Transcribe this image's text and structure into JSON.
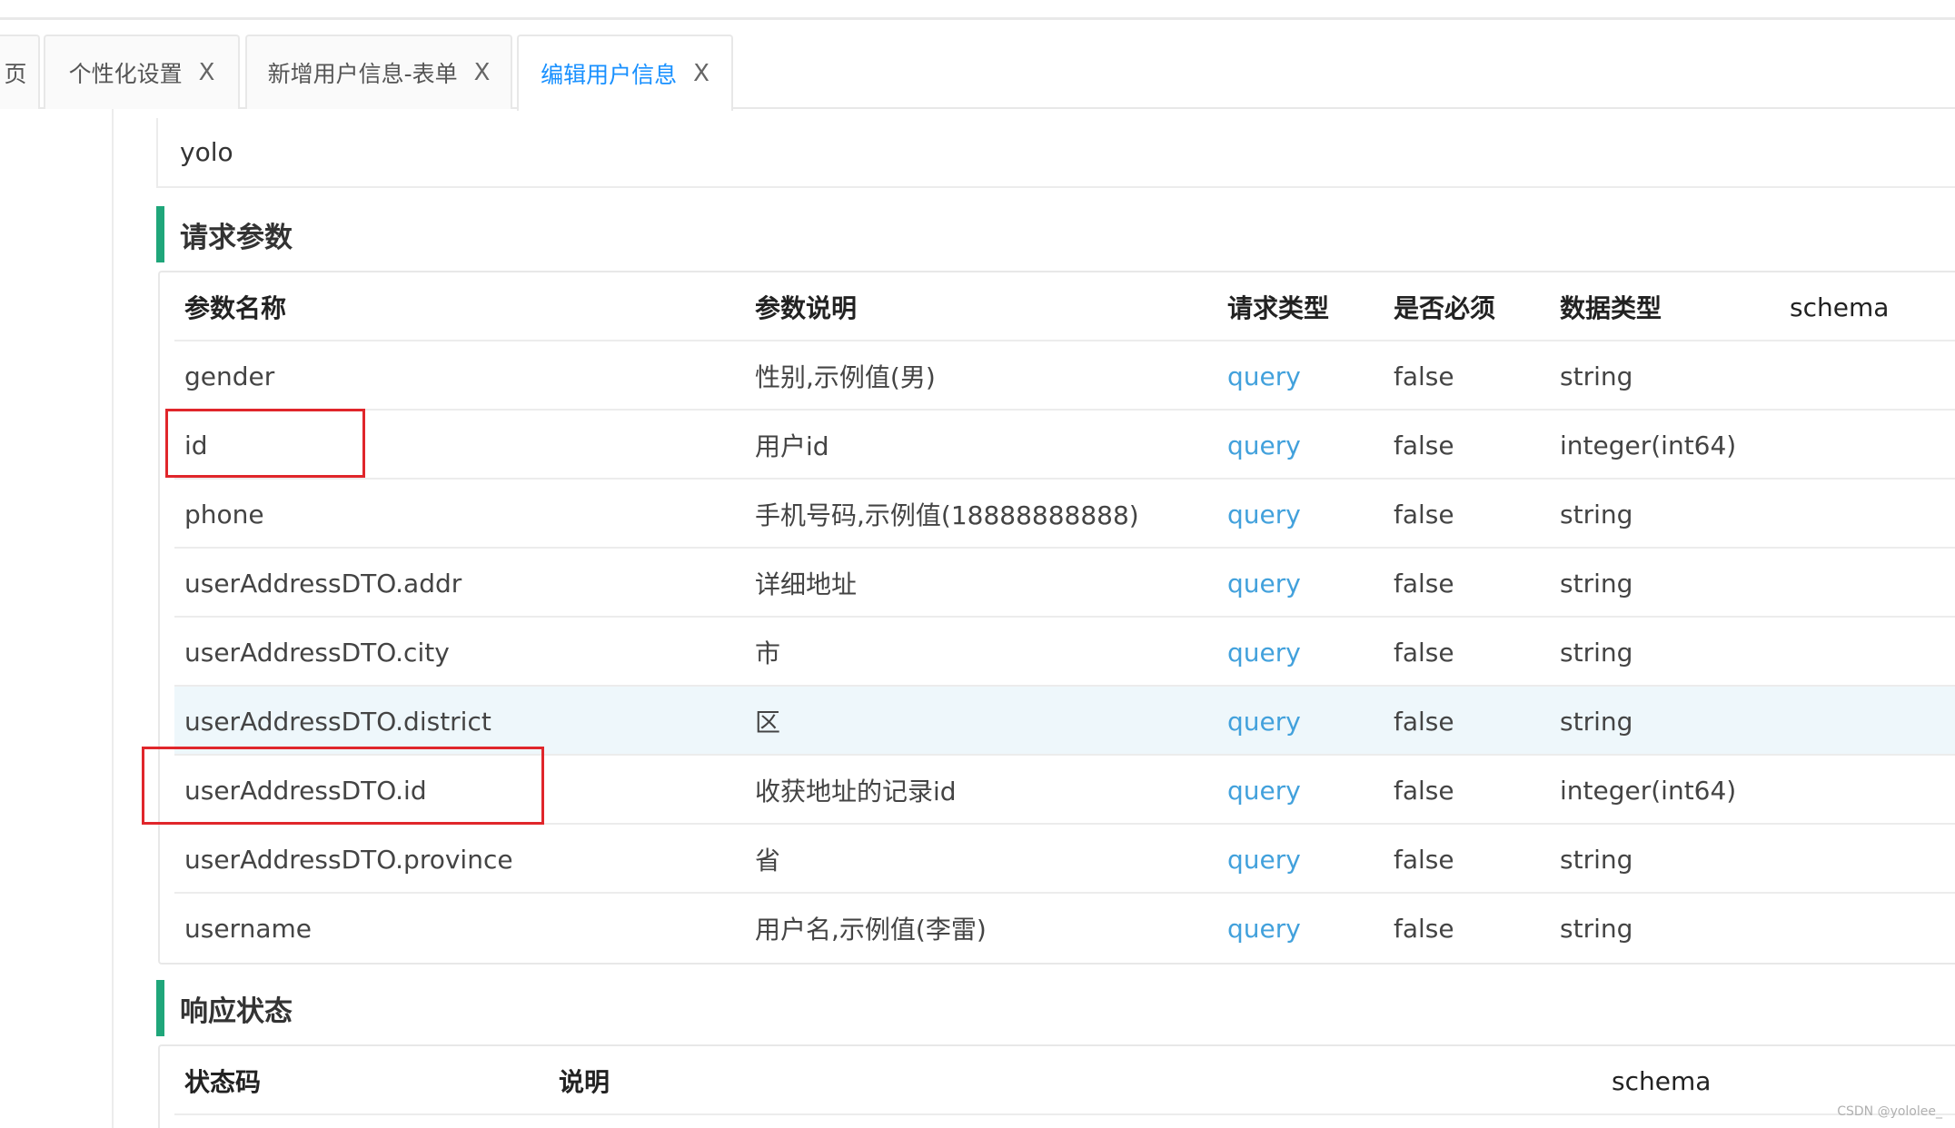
{
  "tabs": [
    {
      "label": "页",
      "active": false,
      "closable": false
    },
    {
      "label": "个性化设置",
      "active": false,
      "closable": true
    },
    {
      "label": "新增用户信息-表单",
      "active": false,
      "closable": true
    },
    {
      "label": "编辑用户信息",
      "active": true,
      "closable": true
    }
  ],
  "close_glyph": "X",
  "url_box": {
    "text": "yolo"
  },
  "request_params": {
    "title": "请求参数",
    "headers": [
      "参数名称",
      "参数说明",
      "请求类型",
      "是否必须",
      "数据类型",
      "schema"
    ],
    "rows": [
      {
        "name": "gender",
        "desc": "性别,示例值(男)",
        "in": "query",
        "required": "false",
        "type": "string"
      },
      {
        "name": "id",
        "desc": "用户id",
        "in": "query",
        "required": "false",
        "type": "integer(int64)"
      },
      {
        "name": "phone",
        "desc": "手机号码,示例值(18888888888)",
        "in": "query",
        "required": "false",
        "type": "string"
      },
      {
        "name": "userAddressDTO.addr",
        "desc": "详细地址",
        "in": "query",
        "required": "false",
        "type": "string"
      },
      {
        "name": "userAddressDTO.city",
        "desc": "市",
        "in": "query",
        "required": "false",
        "type": "string"
      },
      {
        "name": "userAddressDTO.district",
        "desc": "区",
        "in": "query",
        "required": "false",
        "type": "string"
      },
      {
        "name": "userAddressDTO.id",
        "desc": "收获地址的记录id",
        "in": "query",
        "required": "false",
        "type": "integer(int64)"
      },
      {
        "name": "userAddressDTO.province",
        "desc": "省",
        "in": "query",
        "required": "false",
        "type": "string"
      },
      {
        "name": "username",
        "desc": "用户名,示例值(李雷)",
        "in": "query",
        "required": "false",
        "type": "string"
      }
    ],
    "highlighted_row": "userAddressDTO.district"
  },
  "response_status": {
    "title": "响应状态",
    "headers": [
      "状态码",
      "说明",
      "schema"
    ]
  },
  "colors": {
    "accent_bar": "#1fa67a",
    "active_tab": "#1890ff",
    "query_link": "#42a1dc",
    "annotation_box": "#e0262b",
    "row_highlight": "#eef7fb"
  },
  "watermark": "CSDN @yololee_"
}
